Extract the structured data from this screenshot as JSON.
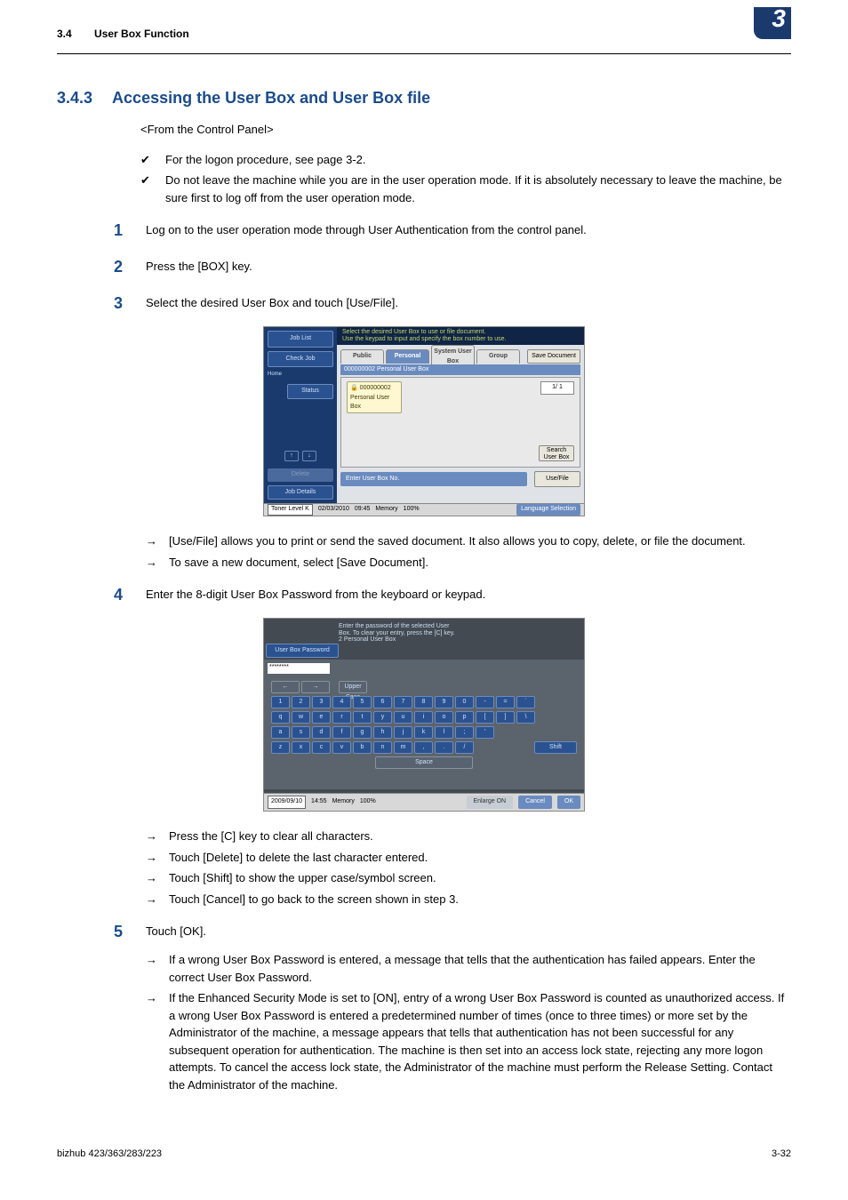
{
  "header": {
    "section_num": "3.4",
    "section_title": "User Box Function",
    "chapter_badge": "3"
  },
  "heading": {
    "num": "3.4.3",
    "title": "Accessing the User Box and User Box file"
  },
  "subtitle": "<From the Control Panel>",
  "prereqs": [
    "For the logon procedure, see page 3-2.",
    "Do not leave the machine while you are in the user operation mode. If it is absolutely necessary to leave the machine, be sure first to log off from the user operation mode."
  ],
  "steps": {
    "1": {
      "num": "1",
      "text": "Log on to the user operation mode through User Authentication from the control panel."
    },
    "2": {
      "num": "2",
      "text": "Press the [BOX] key."
    },
    "3": {
      "num": "3",
      "text": "Select the desired User Box and touch [Use/File]."
    },
    "4": {
      "num": "4",
      "text": "Enter the 8-digit User Box Password from the keyboard or keypad."
    },
    "5": {
      "num": "5",
      "text": "Touch [OK]."
    }
  },
  "arrows_3": [
    "[Use/File] allows you to print or send the saved document. It also allows you to copy, delete, or file the document.",
    "To save a new document, select [Save Document]."
  ],
  "arrows_4": [
    "Press the [C] key to clear all characters.",
    "Touch [Delete] to delete the last character entered.",
    "Touch [Shift] to show the upper case/symbol screen.",
    "Touch [Cancel] to go back to the screen shown in step 3."
  ],
  "arrows_5": [
    "If a wrong User Box Password is entered, a message that tells that the authentication has failed appears. Enter the correct User Box Password.",
    "If the Enhanced Security Mode is set to [ON], entry of a wrong User Box Password is counted as unauthorized access. If a wrong User Box Password is entered a predetermined number of times (once to three times) or more set by the Administrator of the machine, a message appears that tells that authentication has not been successful for any subsequent operation for authentication. The machine is then set into an access lock state, rejecting any more logon attempts. To cancel the access lock state, the Administrator of the machine must perform the Release Setting. Contact the Administrator of the machine."
  ],
  "ss1": {
    "job_list": "Job List",
    "check_job": "Check Job",
    "status": "Status",
    "delete": "Delete",
    "job_details": "Job Details",
    "top_line1": "Select the desired User Box to use or file document.",
    "top_line2": "Use the keypad to input and specify the box number to use.",
    "tabs": {
      "public": "Public",
      "personal": "Personal",
      "system": "System User Box",
      "group": "Group",
      "save": "Save Document"
    },
    "bar2": "000000002  Personal User Box",
    "folder_num": "000000002",
    "folder_label": "Personal User Box",
    "page": "1/  1",
    "search": "Search User Box",
    "enter": "Enter User Box No.",
    "usefile": "Use/File",
    "toner": "Toner Level  K",
    "date": "02/03/2010",
    "time": "09:45",
    "memory": "Memory",
    "mempct": "100%",
    "lang": "Language Selection",
    "home": "Home"
  },
  "ss2": {
    "top1": "Enter the password of the selected User",
    "top2": "Box. To clear your entry, press the [C] key.",
    "top3": "2                  Personal User Box",
    "userbox": "User Box Password",
    "pw_mask": "********",
    "case": "Upper Case",
    "row0": {
      "left_arrow": "←",
      "right_arrow": "→"
    },
    "row1": [
      "1",
      "2",
      "3",
      "4",
      "5",
      "6",
      "7",
      "8",
      "9",
      "0",
      "-",
      "=",
      "`"
    ],
    "row2": [
      "q",
      "w",
      "e",
      "r",
      "t",
      "y",
      "u",
      "i",
      "o",
      "p",
      "[",
      "]",
      "\\"
    ],
    "row3": [
      "a",
      "s",
      "d",
      "f",
      "g",
      "h",
      "j",
      "k",
      "l",
      ";",
      "'"
    ],
    "row4": [
      "z",
      "x",
      "c",
      "v",
      "b",
      "n",
      "m",
      ",",
      ".",
      "/"
    ],
    "shift": "Shift",
    "space": "Space",
    "date": "2009/09/10",
    "time": "14:55",
    "memory": "Memory",
    "mempct": "100%",
    "enlarge": "Enlarge ON",
    "cancel": "Cancel",
    "ok": "OK"
  },
  "footer": {
    "left": "bizhub 423/363/283/223",
    "right": "3-32"
  }
}
